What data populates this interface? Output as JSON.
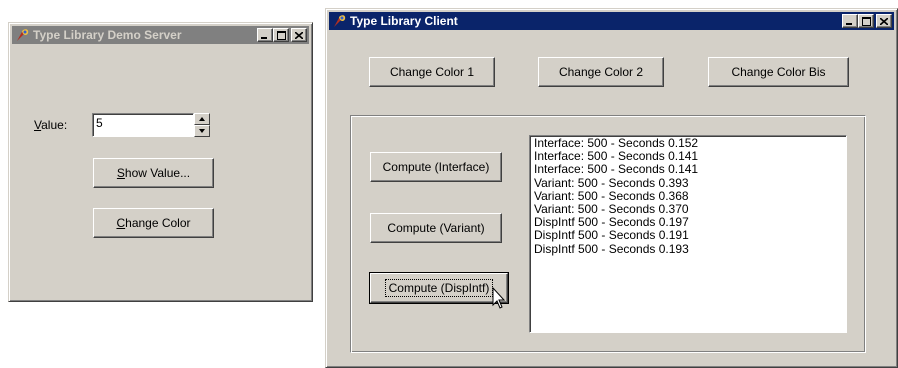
{
  "server_window": {
    "title": "Type Library Demo Server",
    "value_label_accel": "V",
    "value_label_rest": "alue:",
    "value": "5",
    "show_value_accel": "S",
    "show_value_rest": "how Value...",
    "change_color_accel": "C",
    "change_color_rest": "hange Color",
    "title_icon": "app-icon"
  },
  "client_window": {
    "title": "Type Library Client",
    "buttons": {
      "change_color_1": "Change Color 1",
      "change_color_2": "Change Color 2",
      "change_color_bis": "Change Color Bis",
      "compute_interface": "Compute (Interface)",
      "compute_variant": "Compute (Variant)",
      "compute_dispintf": "Compute (DispIntf)"
    },
    "results": [
      "Interface: 500 - Seconds 0.152",
      "Interface: 500 - Seconds 0.141",
      "Interface: 500 - Seconds 0.141",
      "Variant: 500 - Seconds 0.393",
      "Variant: 500 - Seconds 0.368",
      "Variant: 500 - Seconds 0.370",
      "DispIntf 500 - Seconds 0.197",
      "DispIntf 500 - Seconds 0.191",
      "DispIntf 500 - Seconds 0.193"
    ]
  },
  "colors": {
    "window_face": "#d4d0c8",
    "active_title": "#0a246a",
    "inactive_title": "#808080"
  },
  "icons": [
    "app-icon",
    "minimize-icon",
    "maximize-icon",
    "close-icon",
    "spin-up-icon",
    "spin-down-icon",
    "mouse-pointer-icon"
  ]
}
